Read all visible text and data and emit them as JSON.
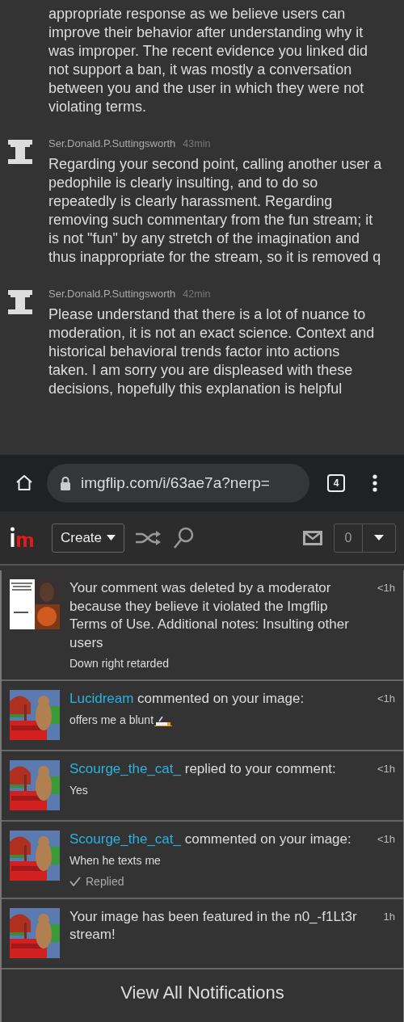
{
  "comments": [
    {
      "text": "appropriate response as we believe users can improve their behavior after understanding why it was improper. The recent evidence you linked did not support a ban, it was mostly a conversation between you and the user in which they were not violating terms."
    },
    {
      "author": "Ser.Donald.P.Suttingsworth",
      "time": "43min",
      "text": "Regarding your second point, calling another user a pedophile is clearly insulting, and to do so repeatedly is clearly harassment. Regarding removing such commentary from the fun stream; it is not \"fun\" by any stretch of the imagination and thus inappropriate for the stream, so it is removed q"
    },
    {
      "author": "Ser.Donald.P.Suttingsworth",
      "time": "42min",
      "text": "Please understand that there is a lot of nuance to moderation, it is not an exact science. Context and historical behavioral trends factor into actions taken. I am sorry you are displeased with these decisions, hopefully this explanation is helpful"
    }
  ],
  "browser": {
    "url": "imgflip.com/i/63ae7a?nerp=",
    "tab_count": "4"
  },
  "navbar": {
    "create_label": "Create",
    "notification_count": "0"
  },
  "notifications": [
    {
      "kind": "deleted",
      "message": "Your comment was deleted by a moderator because they believe it violated the Imgflip Terms of Use. Additional notes: Insulting other users",
      "comment": "Down right retarded",
      "time": "<1h"
    },
    {
      "kind": "activity",
      "user": "Lucidream",
      "action": "commented on your image:",
      "comment": "offers me a blunt",
      "cigarette": true,
      "time": "<1h"
    },
    {
      "kind": "activity",
      "user": "Scourge_the_cat_",
      "action": "replied to your comment:",
      "comment": "Yes",
      "time": "<1h"
    },
    {
      "kind": "activity",
      "user": "Scourge_the_cat_",
      "action": "commented on your image:",
      "comment": "When he texts me",
      "status": "Replied",
      "time": "<1h"
    },
    {
      "kind": "featured",
      "message": "Your image has been featured in the n0_-f1Lt3r stream!",
      "time": "1h"
    }
  ],
  "view_all": "View All Notifications"
}
